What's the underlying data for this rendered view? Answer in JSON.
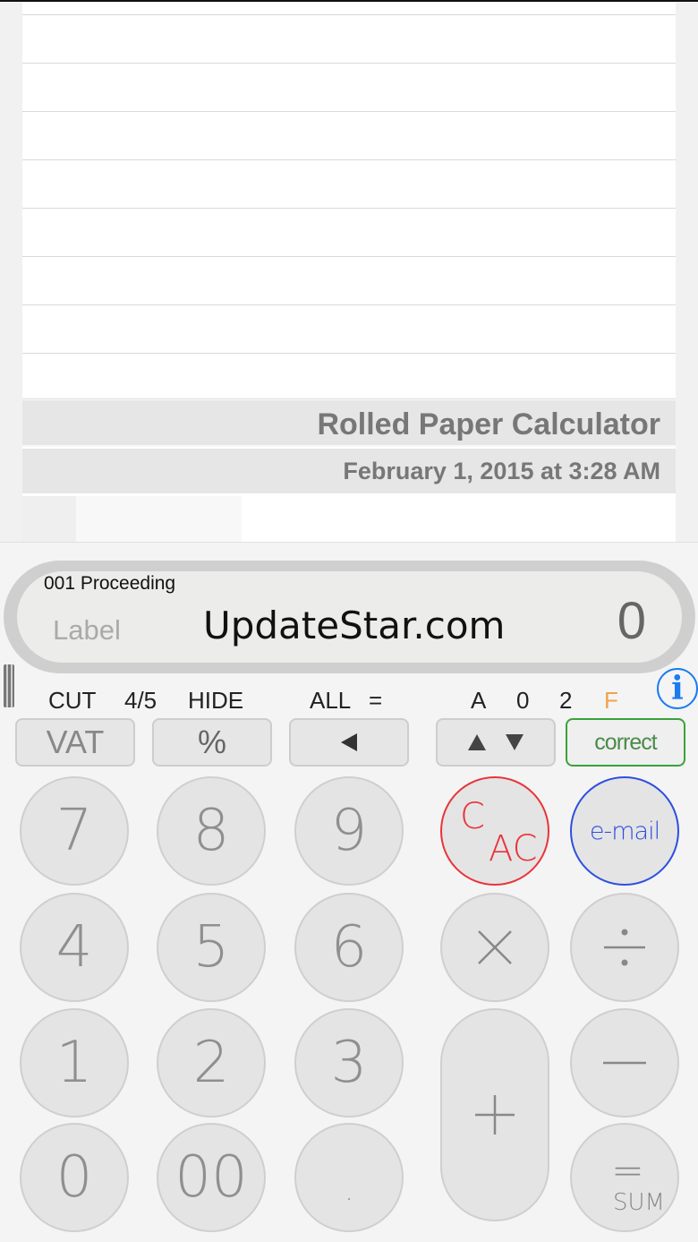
{
  "paper": {
    "title": "Rolled Paper Calculator",
    "date": "February 1, 2015 at 3:28 AM"
  },
  "display": {
    "status": "001 Proceeding",
    "label_placeholder": "Label",
    "watermark": "UpdateStar.com",
    "value": "0"
  },
  "indicators": {
    "cut": "CUT",
    "round": "4/5",
    "hide": "HIDE",
    "all": "ALL",
    "all_eq": "=",
    "mode": "A",
    "decimals_a": "0",
    "decimals_b": "2",
    "flag": "F"
  },
  "function_row": {
    "vat": "VAT",
    "percent": "%",
    "correct": "correct"
  },
  "keys": {
    "k7": "7",
    "k8": "8",
    "k9": "9",
    "k4": "4",
    "k5": "5",
    "k6": "6",
    "k1": "1",
    "k2": "2",
    "k3": "3",
    "k0": "0",
    "k00": "00",
    "dot": ".",
    "clear_c": "C",
    "clear_ac": "AC",
    "email": "e-mail",
    "equals": "=",
    "sum": "SUM"
  },
  "info_icon": "i",
  "colors": {
    "clear_ring": "#e8343a",
    "email_ring": "#2d4fe0",
    "correct_border": "#3aa23a",
    "info_blue": "#1a7cf0",
    "flag_orange": "#f0a44a"
  }
}
